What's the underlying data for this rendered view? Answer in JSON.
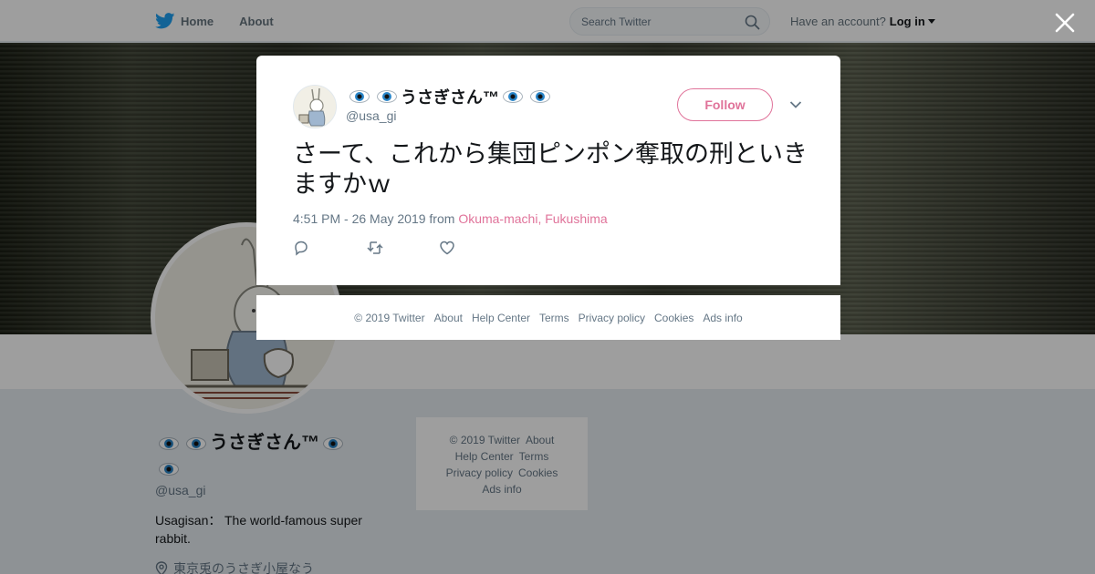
{
  "nav": {
    "home_label": "Home",
    "about_label": "About",
    "search_placeholder": "Search Twitter",
    "account_prompt": "Have an account?",
    "login_label": "Log in"
  },
  "profile": {
    "name": "うさぎさん™",
    "handle": "@usa_gi",
    "bio": "Usagisan： The world-famous super rabbit.",
    "location": "東京兎のうさぎ小屋なう"
  },
  "side_footer": {
    "links": [
      "© 2019 Twitter",
      "About",
      "Help Center",
      "Terms",
      "Privacy policy",
      "Cookies",
      "Ads info"
    ]
  },
  "tweet": {
    "author_name": "うさぎさん™",
    "author_handle": "@usa_gi",
    "follow_label": "Follow",
    "text": "さーて、これから集団ピンポン奪取の刑といきますかｗ",
    "timestamp": "4:51 PM - 26 May 2019",
    "from_label": "from",
    "place": "Okuma-machi, Fukushima"
  },
  "modal_footer": {
    "links": [
      "© 2019 Twitter",
      "About",
      "Help Center",
      "Terms",
      "Privacy policy",
      "Cookies",
      "Ads info"
    ]
  },
  "colors": {
    "brand_blue": "#1da1f2",
    "accent_pink": "#e0739a"
  }
}
